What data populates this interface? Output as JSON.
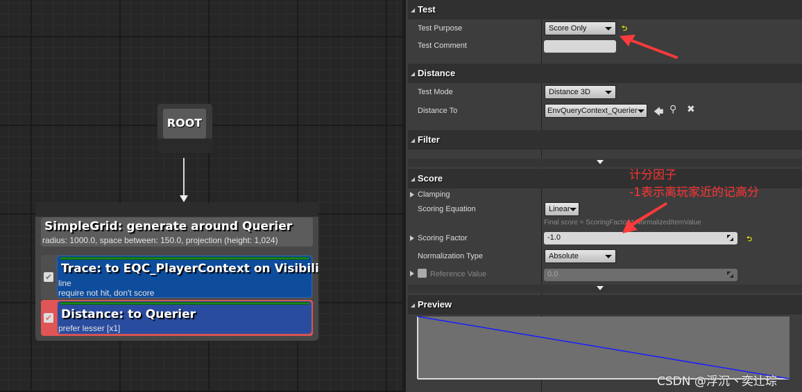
{
  "graph": {
    "root_label": "ROOT",
    "generator": {
      "title": "SimpleGrid: generate around Querier",
      "details": "radius: 1000.0, space between: 150.0, projection (height: 1,024)"
    },
    "tests": [
      {
        "title": "Trace: to EQC_PlayerContext on Visibility",
        "line1": "line",
        "line2": "require not hit, don't score",
        "checked": true,
        "selected": false
      },
      {
        "title": "Distance: to Querier",
        "line1": "prefer lesser [x1]",
        "checked": true,
        "selected": true
      }
    ]
  },
  "details": {
    "test_section": {
      "header": "Test",
      "test_purpose_label": "Test Purpose",
      "test_purpose_value": "Score Only",
      "test_comment_label": "Test Comment",
      "test_comment_value": ""
    },
    "distance_section": {
      "header": "Distance",
      "test_mode_label": "Test Mode",
      "test_mode_value": "Distance 3D",
      "distance_to_label": "Distance To",
      "distance_to_value": "EnvQueryContext_Querier"
    },
    "filter_section": {
      "header": "Filter"
    },
    "score_section": {
      "header": "Score",
      "clamping_label": "Clamping",
      "scoring_equation_label": "Scoring Equation",
      "scoring_equation_value": "Linear",
      "equation_hint": "Final score = ScoringFactor * NormalizedItemValue",
      "scoring_factor_label": "Scoring Factor",
      "scoring_factor_value": "-1.0",
      "normalization_type_label": "Normalization Type",
      "normalization_type_value": "Absolute",
      "reference_value_label": "Reference Value",
      "reference_value_value": "0.0"
    },
    "preview_section": {
      "header": "Preview"
    }
  },
  "chart_data": {
    "type": "line",
    "x": [
      0,
      1
    ],
    "series": [
      {
        "values": [
          1,
          0
        ]
      }
    ],
    "line_color": "#1a1aff",
    "background": "#6f6f6f"
  },
  "annotations": {
    "line1": "计分因子",
    "line2": "-1表示离玩家近的记高分",
    "color": "#ff3333"
  },
  "watermark": "CSDN @浮沉丶奕辻琮"
}
